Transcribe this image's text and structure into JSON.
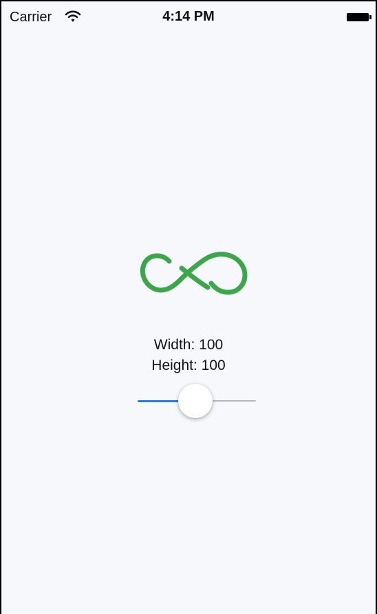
{
  "status_bar": {
    "carrier": "Carrier",
    "time": "4:14 PM",
    "wifi_icon": "wifi-icon",
    "battery_icon": "battery-icon"
  },
  "content": {
    "logo_icon": "infinity-icon",
    "logo_color": "#3aa84a",
    "width_label": "Width: 100",
    "height_label": "Height: 100",
    "slider": {
      "value_fraction": 0.5,
      "min_track_color": "#1e7cf2",
      "max_track_color": "#b6b6b6"
    }
  },
  "colors": {
    "background": "#f7f8fc"
  }
}
